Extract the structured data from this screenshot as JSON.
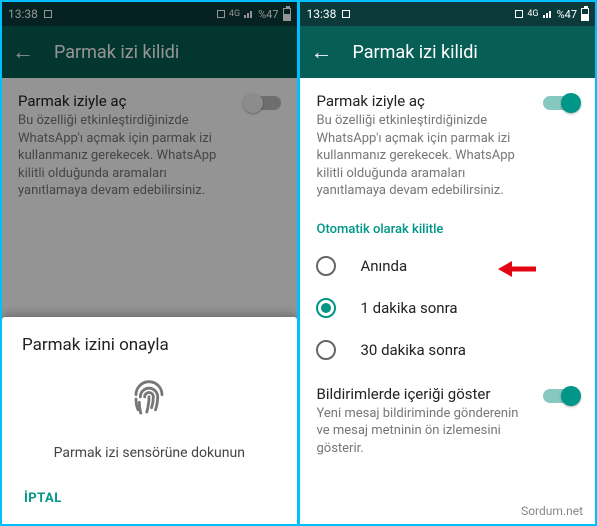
{
  "status": {
    "time": "13:38",
    "battery": "%47"
  },
  "header": {
    "title": "Parmak izi kilidi"
  },
  "unlock": {
    "title": "Parmak iziyle aç",
    "desc": "Bu özelliği etkinleştirdiğinizde WhatsApp'ı açmak için parmak izi kullanmanız gerekecek. WhatsApp kilitli olduğunda aramaları yanıtlamaya devam edebilirsiniz."
  },
  "autolock": {
    "title": "Otomatik olarak kilitle",
    "options": {
      "o0": "Anında",
      "o1": "1 dakika sonra",
      "o2": "30 dakika sonra"
    }
  },
  "notif": {
    "title": "Bildirimlerde içeriği göster",
    "desc": "Yeni mesaj bildiriminde gönderenin ve mesaj metninin ön izlemesini gösterir."
  },
  "sheet": {
    "title": "Parmak izini onayla",
    "instruction": "Parmak izi sensörüne dokunun",
    "cancel": "İPTAL"
  },
  "watermark": "Sordum.net"
}
